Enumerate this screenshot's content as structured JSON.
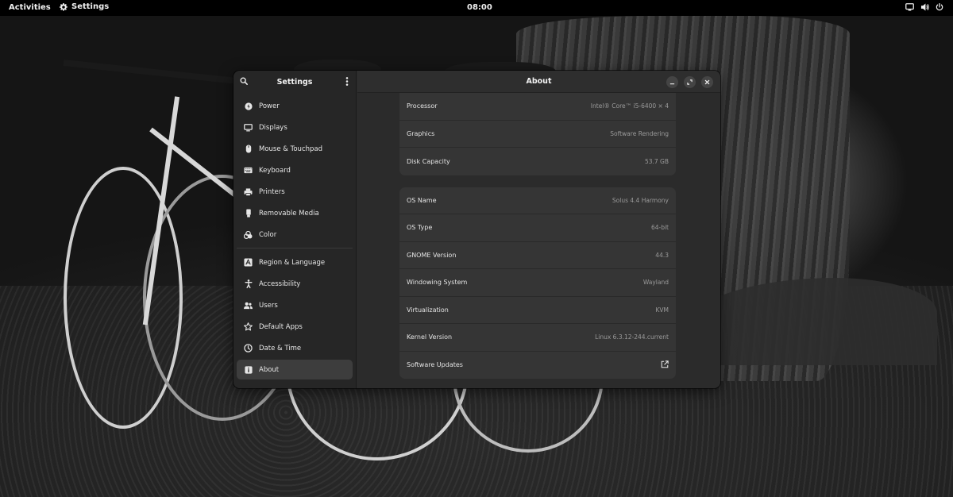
{
  "topbar": {
    "activities": "Activities",
    "app_name": "Settings",
    "clock": "08:00",
    "tray_icons": [
      "screen-icon",
      "volume-icon",
      "power-icon"
    ]
  },
  "sidebar": {
    "title": "Settings",
    "groups": [
      [
        {
          "label": "Power",
          "icon": "power-icon"
        },
        {
          "label": "Displays",
          "icon": "display-icon"
        },
        {
          "label": "Mouse & Touchpad",
          "icon": "mouse-icon"
        },
        {
          "label": "Keyboard",
          "icon": "keyboard-icon"
        },
        {
          "label": "Printers",
          "icon": "printer-icon"
        },
        {
          "label": "Removable Media",
          "icon": "usb-icon"
        },
        {
          "label": "Color",
          "icon": "color-icon"
        }
      ],
      [
        {
          "label": "Region & Language",
          "icon": "language-icon"
        },
        {
          "label": "Accessibility",
          "icon": "accessibility-icon"
        },
        {
          "label": "Users",
          "icon": "users-icon"
        },
        {
          "label": "Default Apps",
          "icon": "star-icon"
        },
        {
          "label": "Date & Time",
          "icon": "clock-icon"
        },
        {
          "label": "About",
          "icon": "info-icon",
          "active": true
        }
      ]
    ]
  },
  "main": {
    "title": "About",
    "hardware": [
      {
        "label": "Processor",
        "value": "Intel® Core™ i5-6400 × 4"
      },
      {
        "label": "Graphics",
        "value": "Software Rendering"
      },
      {
        "label": "Disk Capacity",
        "value": "53.7 GB"
      }
    ],
    "os": [
      {
        "label": "OS Name",
        "value": "Solus 4.4 Harmony"
      },
      {
        "label": "OS Type",
        "value": "64-bit"
      },
      {
        "label": "GNOME Version",
        "value": "44.3"
      },
      {
        "label": "Windowing System",
        "value": "Wayland"
      },
      {
        "label": "Virtualization",
        "value": "KVM"
      },
      {
        "label": "Kernel Version",
        "value": "Linux 6.3.12-244.current"
      },
      {
        "label": "Software Updates",
        "value": "",
        "icon": "external-link-icon"
      }
    ]
  },
  "colors": {
    "window_bg": "#2b2b2b",
    "sidebar_bg": "#262626",
    "card_bg": "#353535",
    "active_item": "#3d3d3d",
    "topbar_bg": "#000000"
  }
}
